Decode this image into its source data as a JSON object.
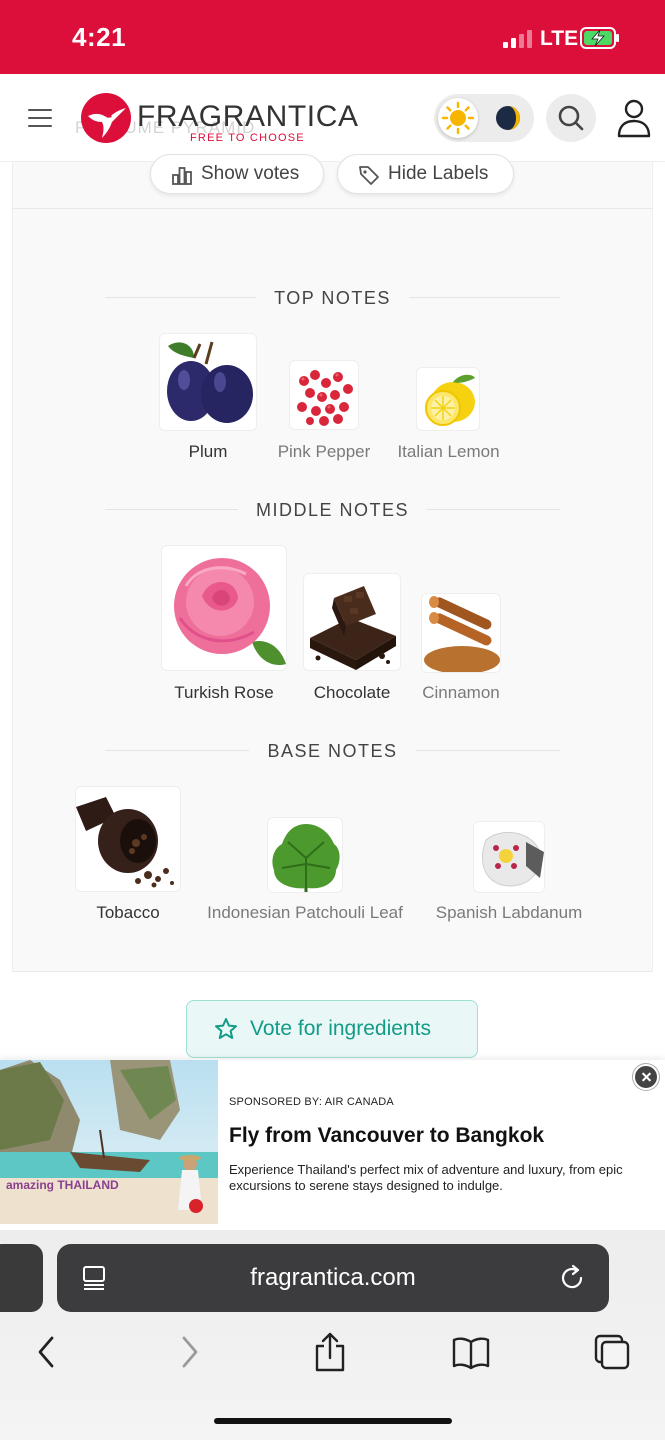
{
  "status_bar": {
    "time": "4:21",
    "network": "LTE",
    "color": "#dc0e3a"
  },
  "header": {
    "logo_name": "FRAGRANTICA",
    "logo_tagline": "FREE TO CHOOSE",
    "ghost_text": "PERFUME PYRAMID",
    "icons": [
      "menu-icon",
      "sun-icon",
      "moon-icon",
      "search-icon",
      "user-icon"
    ]
  },
  "toolbar": {
    "show_votes": "Show votes",
    "hide_labels": "Hide Labels"
  },
  "pyramid": {
    "top": {
      "title": "TOP NOTES",
      "notes": [
        {
          "label": "Plum",
          "icon": "plum-image"
        },
        {
          "label": "Pink Pepper",
          "icon": "pink-pepper-image"
        },
        {
          "label": "Italian Lemon",
          "icon": "lemon-image"
        }
      ]
    },
    "middle": {
      "title": "MIDDLE NOTES",
      "notes": [
        {
          "label": "Turkish Rose",
          "icon": "rose-image"
        },
        {
          "label": "Chocolate",
          "icon": "chocolate-image"
        },
        {
          "label": "Cinnamon",
          "icon": "cinnamon-image"
        }
      ]
    },
    "base": {
      "title": "BASE NOTES",
      "notes": [
        {
          "label": "Tobacco",
          "icon": "tobacco-image"
        },
        {
          "label": "Indonesian Patchouli Leaf",
          "icon": "patchouli-image"
        },
        {
          "label": "Spanish Labdanum",
          "icon": "labdanum-image"
        }
      ]
    }
  },
  "vote_button": {
    "label": "Vote for ingredients",
    "color": "#139b88"
  },
  "ad": {
    "sponsor": "SPONSORED BY: AIR CANADA",
    "title": "Fly from Vancouver to Bangkok",
    "body": "Experience Thailand's perfect mix of adventure and luxury, from epic excursions to serene stays designed to indulge.",
    "image_brand_text": "amazing THAILAND"
  },
  "browser": {
    "url": "fragrantica.com",
    "icons": [
      "tab-overview-icon",
      "reload-icon",
      "back-icon",
      "forward-icon",
      "share-icon",
      "bookmarks-icon",
      "tabs-icon"
    ]
  }
}
